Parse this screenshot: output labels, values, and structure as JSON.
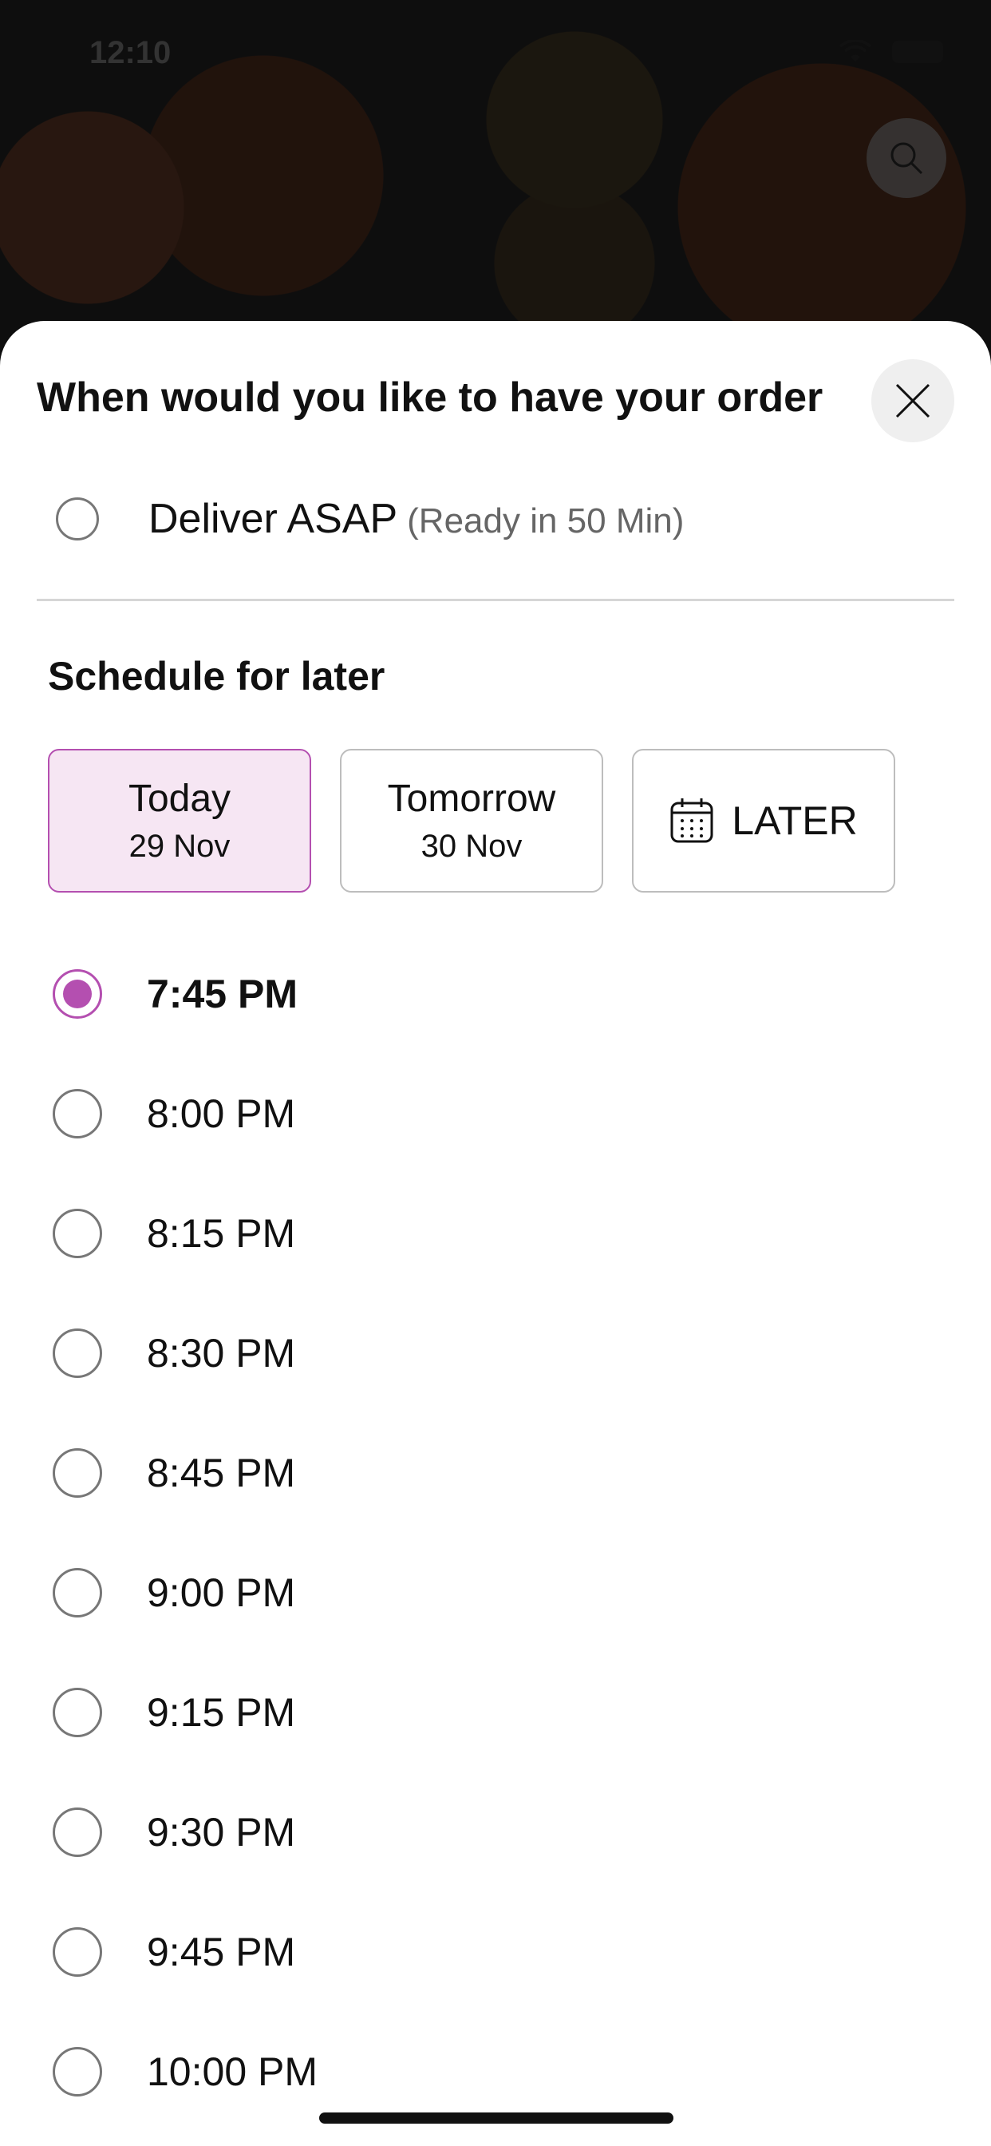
{
  "status_bar": {
    "time": "12:10"
  },
  "sheet": {
    "title": "When would you like to have your order",
    "asap": {
      "label": "Deliver ASAP",
      "sub": "(Ready in 50 Min)"
    },
    "schedule_title": "Schedule for later",
    "day_options": [
      {
        "day": "Today",
        "date": "29 Nov"
      },
      {
        "day": "Tomorrow",
        "date": "30 Nov"
      }
    ],
    "later_label": "LATER",
    "time_slots": [
      "7:45 PM",
      "8:00 PM",
      "8:15 PM",
      "8:30 PM",
      "8:45 PM",
      "9:00 PM",
      "9:15 PM",
      "9:30 PM",
      "9:45 PM",
      "10:00 PM"
    ],
    "selected_slot": "7:45 PM"
  },
  "colors": {
    "accent": "#b44fb0",
    "chip_active_bg": "#f6e6f3"
  },
  "icons": [
    "search-icon",
    "close-icon",
    "calendar-icon",
    "wifi-icon",
    "battery-icon"
  ]
}
